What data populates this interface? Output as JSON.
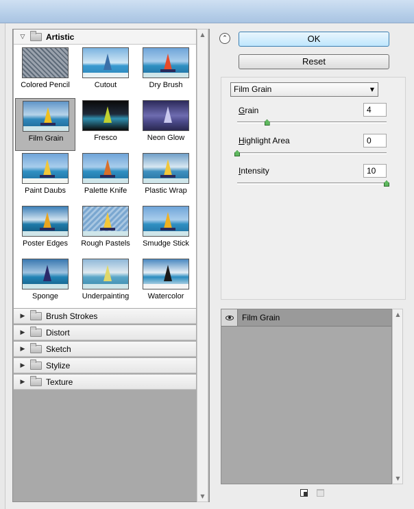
{
  "categories": {
    "artistic": "Artistic",
    "collapsed": [
      "Brush Strokes",
      "Distort",
      "Sketch",
      "Stylize",
      "Texture"
    ]
  },
  "filters": [
    "Colored Pencil",
    "Cutout",
    "Dry Brush",
    "Film Grain",
    "Fresco",
    "Neon Glow",
    "Paint Daubs",
    "Palette Knife",
    "Plastic Wrap",
    "Poster Edges",
    "Rough Pastels",
    "Smudge Stick",
    "Sponge",
    "Underpainting",
    "Watercolor"
  ],
  "selected_filter": "Film Grain",
  "buttons": {
    "ok": "OK",
    "reset": "Reset"
  },
  "dropdown_value": "Film Grain",
  "params": {
    "grain": {
      "label_key": "G",
      "label_rest": "rain",
      "value": "4",
      "level": 0.2
    },
    "highlight": {
      "label_key": "H",
      "label_rest": "ighlight Area",
      "value": "0",
      "level": 0
    },
    "intensity": {
      "label_key": "I",
      "label_rest": "ntensity",
      "value": "10",
      "level": 1
    }
  },
  "layers": {
    "name": "Film Grain"
  },
  "icons": {
    "collapse": "double-chevron-up-icon",
    "eye": "eye-icon",
    "new_layer": "new-effect-layer-icon",
    "delete": "trash-icon"
  }
}
